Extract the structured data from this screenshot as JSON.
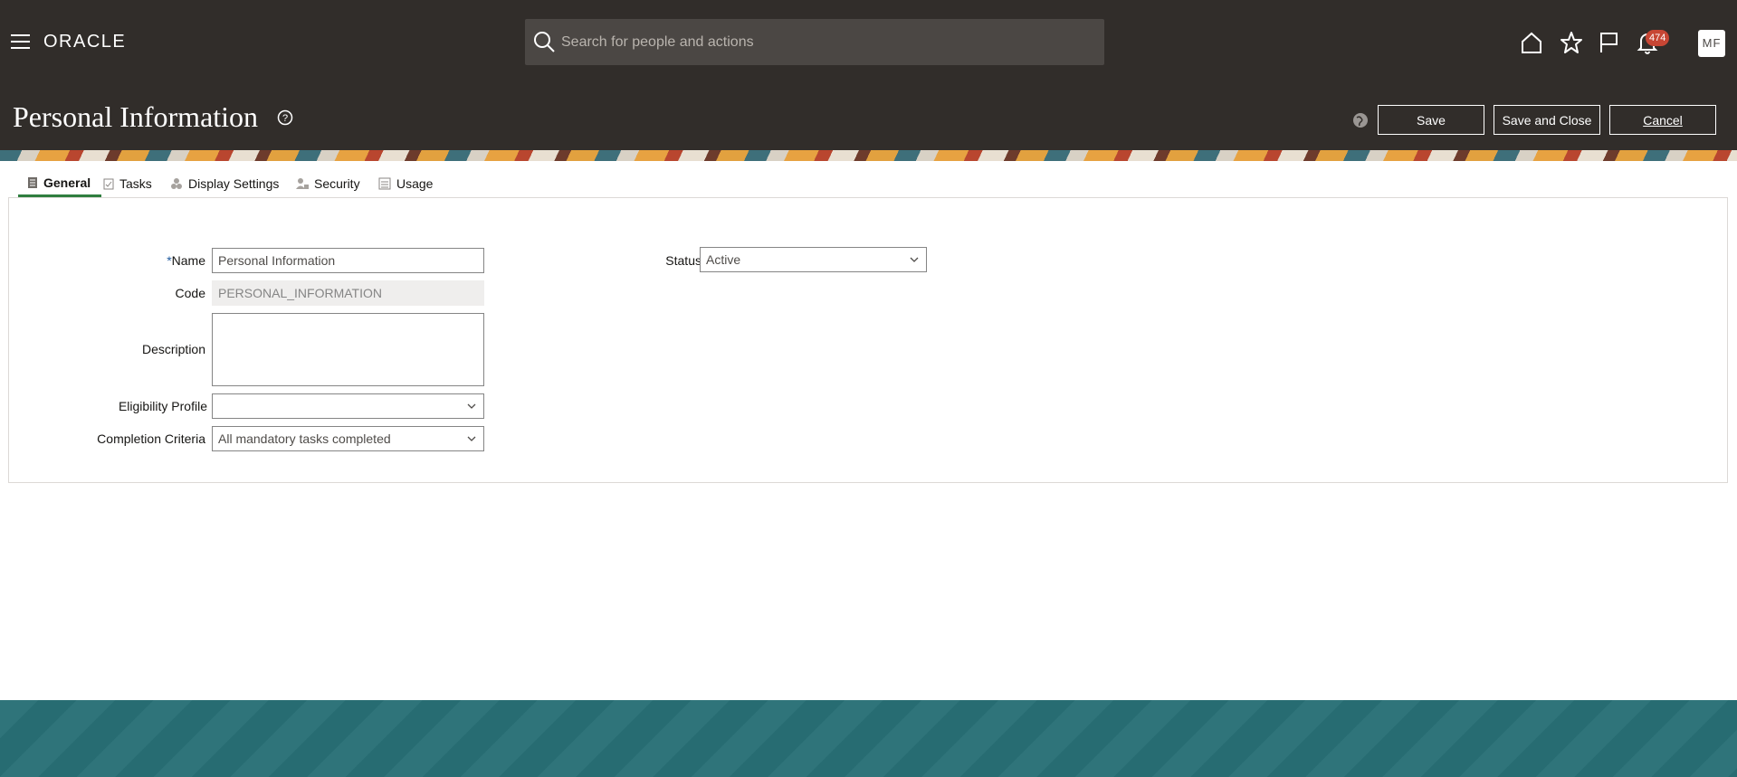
{
  "header": {
    "brand": "ORACLE",
    "search_placeholder": "Search for people and actions",
    "notification_count": "474",
    "avatar_initials": "MF",
    "icons": [
      "hamburger-icon",
      "home-icon",
      "star-icon",
      "flag-icon",
      "bell-icon"
    ]
  },
  "page": {
    "title": "Personal Information",
    "actions": {
      "save": "Save",
      "save_close": "Save and Close",
      "cancel": "Cancel"
    }
  },
  "tabs": [
    {
      "label": "General",
      "active": true
    },
    {
      "label": "Tasks",
      "active": false
    },
    {
      "label": "Display Settings",
      "active": false
    },
    {
      "label": "Security",
      "active": false
    },
    {
      "label": "Usage",
      "active": false
    }
  ],
  "form": {
    "required_marker": "*",
    "name": {
      "label": "Name",
      "value": "Personal Information"
    },
    "code": {
      "label": "Code",
      "value": "PERSONAL_INFORMATION"
    },
    "description": {
      "label": "Description",
      "value": ""
    },
    "eligibility": {
      "label": "Eligibility Profile",
      "value": ""
    },
    "completion": {
      "label": "Completion Criteria",
      "value": "All mandatory tasks completed"
    },
    "status": {
      "label": "Status",
      "value": "Active"
    }
  },
  "colors": {
    "header_bg": "#312d2a",
    "active_tab": "#2f7e3f",
    "badge": "#c74634",
    "footer": "#286f76"
  }
}
